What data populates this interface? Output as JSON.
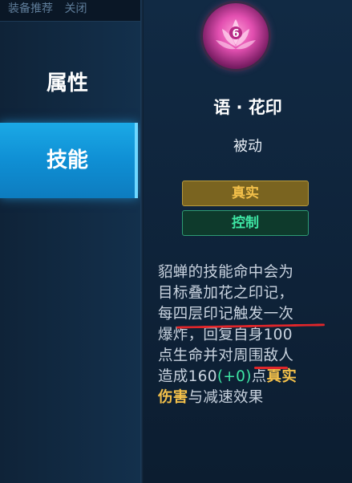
{
  "top_tabs": [
    "装备推荐",
    "关闭"
  ],
  "sidebar": {
    "items": [
      {
        "label": "属性",
        "selected": false
      },
      {
        "label": "技能",
        "selected": true
      }
    ]
  },
  "skill": {
    "icon": "lotus-emblem-icon",
    "icon_badge": "6",
    "name": "语 · 花印",
    "type": "被动",
    "tags": [
      "真实",
      "控制"
    ],
    "description_lines": [
      {
        "parts": [
          {
            "text": "貂蝉的技能命中会为",
            "style": "normal"
          }
        ]
      },
      {
        "parts": [
          {
            "text": "目标叠加花之印记，",
            "style": "normal"
          }
        ]
      },
      {
        "parts": [
          {
            "text": "每四层印记触发一次",
            "style": "normal"
          }
        ]
      },
      {
        "parts": [
          {
            "text": "爆炸，回复自身100",
            "style": "normal"
          }
        ]
      },
      {
        "parts": [
          {
            "text": "点生命并对周围敌人",
            "style": "normal"
          }
        ]
      },
      {
        "parts": [
          {
            "text": "造成160",
            "style": "normal"
          },
          {
            "text": "(+0)",
            "style": "green"
          },
          {
            "text": "点",
            "style": "normal"
          },
          {
            "text": "真实",
            "style": "gold"
          }
        ]
      },
      {
        "parts": [
          {
            "text": "伤害",
            "style": "gold"
          },
          {
            "text": "与减速效果",
            "style": "normal"
          }
        ]
      }
    ]
  },
  "colors": {
    "accent_blue": "#1ba9e6",
    "tag_true": "#f3c04a",
    "tag_control": "#3ee6a4",
    "annotation_red": "#e0262a"
  }
}
